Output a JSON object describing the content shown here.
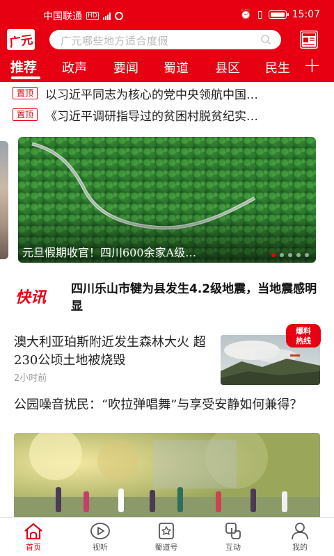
{
  "status_bar": {
    "carrier": "中国联通",
    "time": "15:07"
  },
  "app": {
    "logo_text": "广元",
    "search_placeholder": "广元哪些地方适合度假",
    "brand_color": "#e60012"
  },
  "tabs": [
    {
      "label": "推荐",
      "active": true
    },
    {
      "label": "政声"
    },
    {
      "label": "要闻"
    },
    {
      "label": "蜀道"
    },
    {
      "label": "县区"
    },
    {
      "label": "民生"
    }
  ],
  "pinned": [
    {
      "badge": "置顶",
      "title": "以习近平同志为核心的党中央领航中国…"
    },
    {
      "badge": "置顶",
      "title": "《习近平调研指导过的贫困村脱贫纪实…"
    }
  ],
  "banner": {
    "caption": "元旦假期收官！四川600余家A级…",
    "dot_count": 5,
    "active_dot": 0
  },
  "kuaixun": {
    "logo_text": "快讯",
    "text": "四川乐山市犍为县发生4.2级地震，当地震感明显"
  },
  "article1": {
    "title": "澳大利亚珀斯附近发生森林大火 超230公顷土地被烧毁",
    "time": "2小时前",
    "badge_line1": "爆料",
    "badge_line2": "热线"
  },
  "article2": {
    "title": "公园噪音扰民：“吹拉弹唱舞”与享受安静如何兼得？"
  },
  "bottom_nav": [
    {
      "label": "首页",
      "icon": "home-icon",
      "active": true
    },
    {
      "label": "视听",
      "icon": "play-icon"
    },
    {
      "label": "蜀道号",
      "icon": "star-badge-icon"
    },
    {
      "label": "互动",
      "icon": "hand-icon"
    },
    {
      "label": "我的",
      "icon": "person-icon"
    }
  ]
}
